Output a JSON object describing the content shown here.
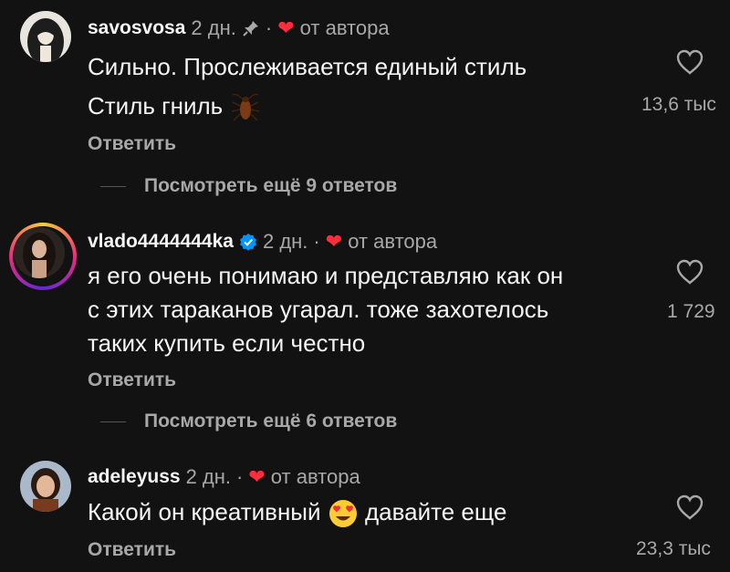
{
  "comments": [
    {
      "username": "savosvosa",
      "time": "2 дн.",
      "dot": "·",
      "author_like": "от автора",
      "pinned": true,
      "lines": [
        "Сильно. Прослеживается единый стиль",
        "Стиль гниль"
      ],
      "reply_label": "Ответить",
      "likes": "13,6 тыс",
      "more_replies": "Посмотреть ещё 9 ответов"
    },
    {
      "username": "vlado4444444ka",
      "time": "2 дн.",
      "dot": "·",
      "author_like": "от автора",
      "verified": true,
      "lines": [
        "я его очень понимаю и представляю как он",
        "с этих тараканов угарал. тоже захотелось",
        "таких купить если честно"
      ],
      "reply_label": "Ответить",
      "likes": "1 729",
      "more_replies": "Посмотреть ещё 6 ответов"
    },
    {
      "username": "adeleyuss",
      "time": "2 дн.",
      "dot": "·",
      "author_like": "от автора",
      "text_before_emoji": "Какой он креативный",
      "text_after_emoji": "давайте еще",
      "reply_label": "Ответить",
      "likes": "23,3 тыс"
    }
  ],
  "colors": {
    "background": "#121212",
    "text": "#f5f5f5",
    "secondary": "#a8a8a8",
    "heart": "#ff2d3d",
    "verified": "#0095f6"
  },
  "icons": [
    "pin-icon",
    "heart-icon",
    "verified-icon",
    "cockroach-emoji",
    "heart-eyes-emoji"
  ]
}
